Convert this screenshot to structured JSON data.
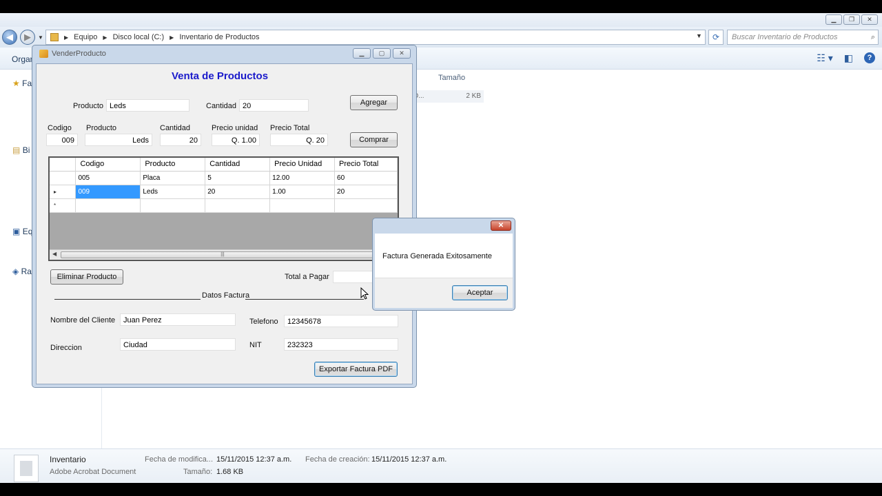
{
  "explorer": {
    "back_icon": "back-arrow-icon",
    "forward_icon": "forward-arrow-icon",
    "breadcrumbs": [
      "Equipo",
      "Disco local (C:)",
      "Inventario de Productos"
    ],
    "search_placeholder": "Buscar Inventario de Productos",
    "toolbar_label": "Organ",
    "column_header": "Tamaño",
    "file_row": {
      "name": "D...",
      "size": "2 KB"
    },
    "nav_items": [
      "Fa",
      "Bi",
      "Eq",
      "Ra"
    ],
    "details": {
      "name": "Inventario",
      "type": "Adobe Acrobat Document",
      "modified_label": "Fecha de modifica...",
      "modified_value": "15/11/2015 12:37 a.m.",
      "created_label": "Fecha de creación:",
      "created_value": "15/11/2015 12:37 a.m.",
      "size_label": "Tamaño:",
      "size_value": "1.68 KB"
    }
  },
  "form": {
    "window_title": "VenderProducto",
    "heading": "Venta de Productos",
    "producto_label": "Producto",
    "producto_value": "Leds",
    "cantidad_label": "Cantidad",
    "cantidad_value": "20",
    "agregar_button": "Agregar",
    "comprar_button": "Comprar",
    "detail_labels": {
      "codigo": "Codigo",
      "producto": "Producto",
      "cantidad": "Cantidad",
      "precio_unidad": "Precio unidad",
      "precio_total": "Precio Total"
    },
    "detail_values": {
      "codigo": "009",
      "producto": "Leds",
      "cantidad": "20",
      "precio_unidad": "Q. 1.00",
      "precio_total": "Q. 20"
    },
    "grid": {
      "columns": [
        "Codigo",
        "Producto",
        "Cantidad",
        "Precio Unidad",
        "Precio Total"
      ],
      "rows": [
        [
          "005",
          "Placa",
          "5",
          "12.00",
          "60"
        ],
        [
          "009",
          "Leds",
          "20",
          "1.00",
          "20"
        ]
      ],
      "current_row_marker": "▸",
      "new_row_marker": "*",
      "scroll_grip": "|||"
    },
    "eliminar_button": "Eliminar Producto",
    "total_label": "Total a Pagar",
    "total_value": "",
    "datos_factura_label": "Datos Factura",
    "cliente_label": "Nombre del Cliente",
    "cliente_value": "Juan Perez",
    "telefono_label": "Telefono",
    "telefono_value": "12345678",
    "direccion_label": "Direccion",
    "direccion_value": "Ciudad",
    "nit_label": "NIT",
    "nit_value": "232323",
    "exportar_button": "Exportar Factura PDF"
  },
  "message_box": {
    "message": "Factura Generada Exitosamente",
    "ok_button": "Aceptar",
    "close_glyph": "✕"
  }
}
